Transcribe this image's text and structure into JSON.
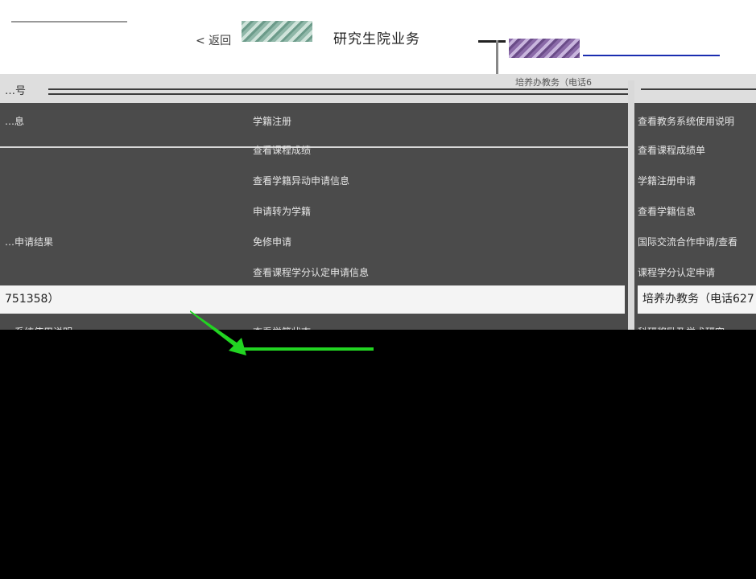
{
  "header": {
    "back_link": "< 返回",
    "page_title": "研究生院业务"
  },
  "toolbar": {
    "left_label": "…号",
    "right_label": "培养办教务（电话6"
  },
  "left_panel": {
    "col1": [
      "…息",
      "…申请结果"
    ],
    "col1_sub": "…系统使用说明",
    "col2": [
      "学籍注册",
      "查看课程成绩",
      "查看学籍异动申请信息",
      "申请转为学籍",
      "免修申请",
      "查看课程学分认定申请信息",
      "查看学籍状态"
    ],
    "info_bar": "751358）"
  },
  "right_panel": {
    "items": [
      "查看教务系统使用说明",
      "查看课程成绩单",
      "学籍注册申请",
      "查看学籍信息",
      "国际交流合作申请/查看",
      "课程学分认定申请"
    ],
    "sub": "科研奖励及学术研究",
    "info_bar": "培养办教务（电话627"
  },
  "colors": {
    "panel": "#4b4b4b",
    "toolbar": "#dedede",
    "accent_blue": "#1a2db0",
    "accent_green": "#22d422"
  }
}
